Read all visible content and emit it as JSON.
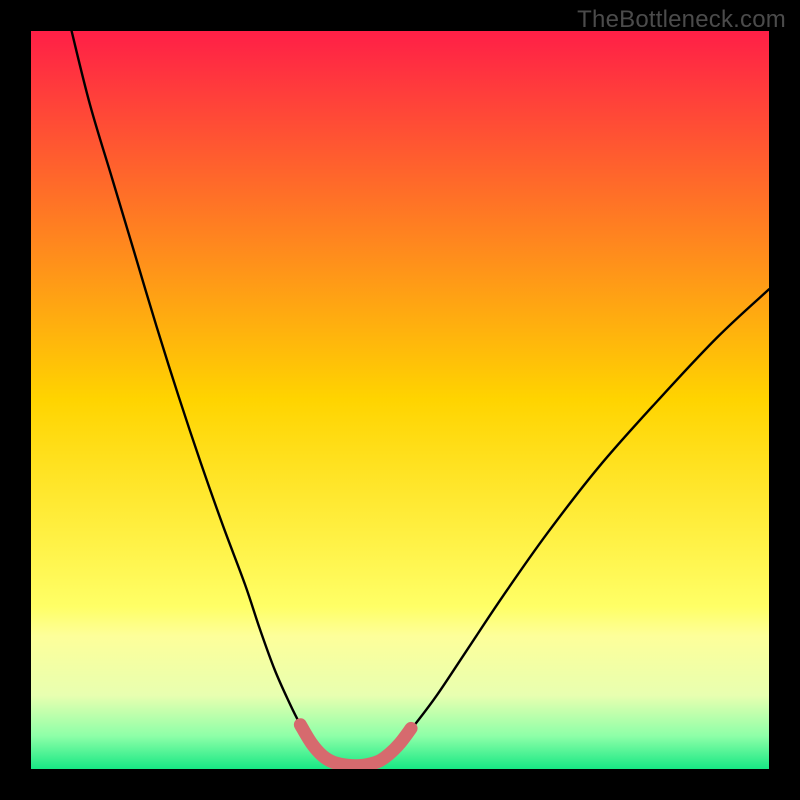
{
  "watermark": "TheBottleneck.com",
  "chart_data": {
    "type": "line",
    "title": "",
    "xlabel": "",
    "ylabel": "",
    "xlim": [
      0,
      100
    ],
    "ylim": [
      0,
      100
    ],
    "gradient_stops": [
      {
        "offset": 0.0,
        "color": "#ff1f47"
      },
      {
        "offset": 0.5,
        "color": "#ffd400"
      },
      {
        "offset": 0.78,
        "color": "#ffff66"
      },
      {
        "offset": 0.82,
        "color": "#fdff9a"
      },
      {
        "offset": 0.9,
        "color": "#e8ffb0"
      },
      {
        "offset": 0.955,
        "color": "#8effa8"
      },
      {
        "offset": 1.0,
        "color": "#17e884"
      }
    ],
    "series": [
      {
        "name": "left-branch",
        "x": [
          5.5,
          8,
          11,
          14,
          17,
          20,
          23,
          26,
          29,
          31,
          33,
          35,
          36.5,
          38,
          39.5
        ],
        "y": [
          100,
          90,
          80,
          70,
          60,
          50.5,
          41.5,
          33,
          25,
          19,
          13.5,
          9,
          6,
          3.5,
          1.8
        ]
      },
      {
        "name": "right-branch",
        "x": [
          48,
          50,
          52,
          55,
          59,
          64,
          70,
          77,
          85,
          93,
          100
        ],
        "y": [
          1.8,
          3.5,
          6,
          10,
          16,
          23.5,
          32,
          41,
          50,
          58.5,
          65
        ]
      },
      {
        "name": "valley-highlight",
        "x": [
          36.5,
          38,
          39.5,
          41,
          43,
          45,
          47,
          48.5,
          50,
          51.5
        ],
        "y": [
          6,
          3.5,
          1.8,
          0.9,
          0.5,
          0.5,
          1.0,
          2.0,
          3.5,
          5.5
        ]
      }
    ]
  }
}
